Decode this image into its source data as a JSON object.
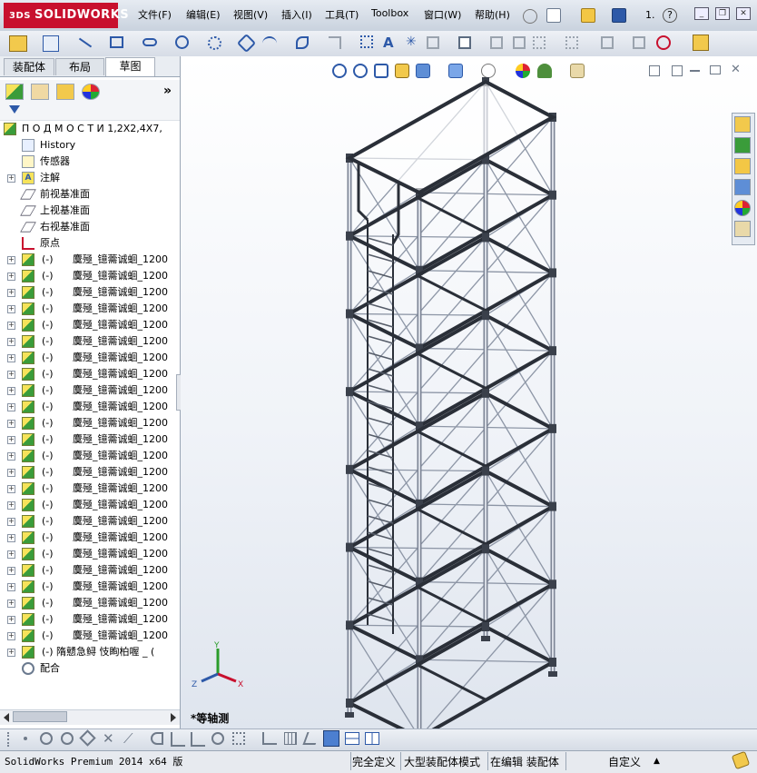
{
  "app": {
    "brand": "SOLIDWORKS",
    "brand_prefix": "3DS"
  },
  "menu": [
    {
      "label": "文件(F)"
    },
    {
      "label": "编辑(E)"
    },
    {
      "label": "视图(V)"
    },
    {
      "label": "插入(I)"
    },
    {
      "label": "工具(T)"
    },
    {
      "label": "Toolbox"
    },
    {
      "label": "窗口(W)"
    },
    {
      "label": "帮助(H)"
    }
  ],
  "title_right": {
    "counter": "1."
  },
  "tabs": [
    {
      "label": "装配体"
    },
    {
      "label": "布局"
    },
    {
      "label": "草图"
    }
  ],
  "tree": {
    "root": "П О Д М О С Т И 1,2X2,4X7,",
    "items": [
      {
        "label": "History",
        "icon": "history-icon"
      },
      {
        "label": "传感器",
        "icon": "sensor-icon"
      },
      {
        "label": "注解",
        "icon": "annotation-icon"
      },
      {
        "label": "前视基准面",
        "icon": "plane-icon"
      },
      {
        "label": "上视基准面",
        "icon": "plane-icon"
      },
      {
        "label": "右视基准面",
        "icon": "plane-icon"
      },
      {
        "label": "原点",
        "icon": "origin-icon"
      }
    ],
    "part_prefix": "(-)",
    "part_name": "麌殛_镱薷诚蛔_1200",
    "part_count": 24,
    "subassembly": "(-) 隋戆急鲟 忮眴柏喔  _ (",
    "mates": "配合"
  },
  "viewport": {
    "view_name": "*等轴测"
  },
  "triad": {
    "x": "X",
    "y": "Y",
    "z": "Z"
  },
  "status": {
    "product": "SolidWorks Premium 2014 x64 版",
    "definition": "完全定义",
    "mode": "大型装配体模式",
    "editing": "在编辑 装配体",
    "custom": "自定义"
  },
  "colors": {
    "brand_red": "#c8102e",
    "frame": "#2a2f38",
    "brace": "#8d96a6",
    "panel": "#ffffff"
  }
}
